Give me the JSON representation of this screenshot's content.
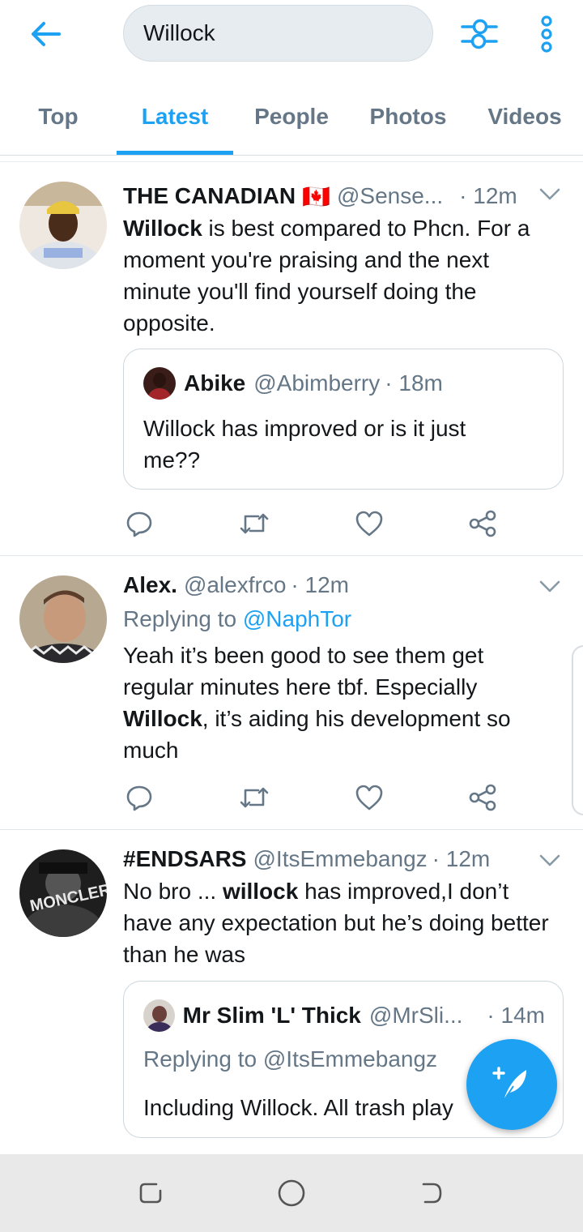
{
  "search": {
    "value": "Willock"
  },
  "tabs": [
    {
      "label": "Top"
    },
    {
      "label": "Latest",
      "active": true
    },
    {
      "label": "People"
    },
    {
      "label": "Photos"
    },
    {
      "label": "Videos"
    }
  ],
  "tweets": [
    {
      "name": "THE CANADIAN",
      "flag": "🇨🇦",
      "handle": "@Sense...",
      "time": "· 12m",
      "text_bold": "Willock",
      "text_rest": " is best compared to Phcn. For a moment you're praising and the next minute you'll find yourself doing the opposite.",
      "quote": {
        "name": "Abike",
        "handle": "@Abimberry",
        "time": "· 18m",
        "text": "Willock has improved or is it just me??"
      }
    },
    {
      "name": "Alex.",
      "handle": "@alexfrco",
      "time": "· 12m",
      "replying_prefix": "Replying to ",
      "replying_to": "@NaphTor",
      "text_pre": "Yeah it’s been good to see them get regular minutes here tbf. Especially ",
      "text_bold": "Willock",
      "text_post": ", it’s aiding his development so much"
    },
    {
      "name": "#ENDSARS",
      "handle": "@ItsEmmebangz",
      "time": "· 12m",
      "text_pre": "No bro ... ",
      "text_bold": "willock",
      "text_post": " has improved,I don’t have any expectation but he’s doing better than he was",
      "quote": {
        "name": "Mr Slim 'L' Thick",
        "handle": "@MrSli...",
        "time": "· 14m",
        "replying": "Replying to @ItsEmmebangz",
        "text": "Including Willock. All trash play"
      }
    }
  ],
  "colors": {
    "accent": "#1da1f2",
    "secondary_text": "#657786",
    "primary_text": "#14171a"
  },
  "icons": {
    "back": "arrow-left-icon",
    "filter": "sliders-icon",
    "more": "vertical-dots-icon",
    "reply": "reply-bubble-icon",
    "retweet": "retweet-icon",
    "like": "heart-icon",
    "share": "share-icon",
    "compose": "compose-feather-icon"
  }
}
